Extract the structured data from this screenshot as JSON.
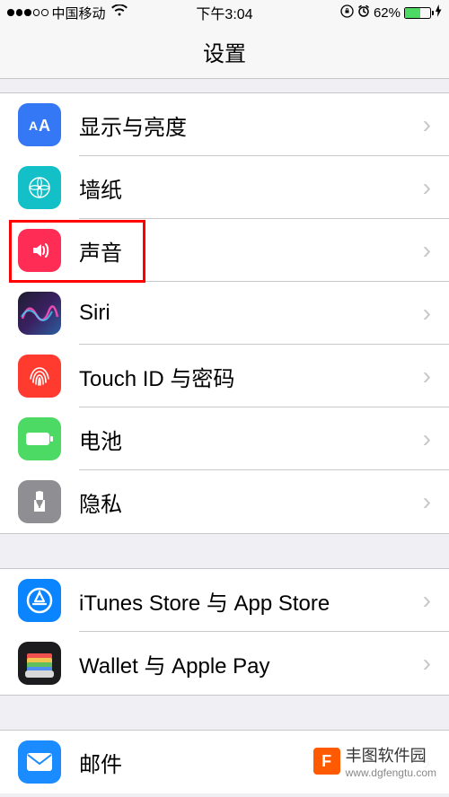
{
  "status": {
    "carrier": "中国移动",
    "time": "下午3:04",
    "battery_pct": "62%"
  },
  "nav": {
    "title": "设置"
  },
  "groups": [
    {
      "items": [
        {
          "key": "display",
          "label": "显示与亮度",
          "icon": "display-brightness-icon"
        },
        {
          "key": "wallpaper",
          "label": "墙纸",
          "icon": "wallpaper-icon"
        },
        {
          "key": "sound",
          "label": "声音",
          "icon": "sound-icon",
          "highlighted": true
        },
        {
          "key": "siri",
          "label": "Siri",
          "icon": "siri-icon"
        },
        {
          "key": "touchid",
          "label": "Touch ID 与密码",
          "icon": "touchid-icon"
        },
        {
          "key": "battery",
          "label": "电池",
          "icon": "battery-icon"
        },
        {
          "key": "privacy",
          "label": "隐私",
          "icon": "privacy-icon"
        }
      ]
    },
    {
      "items": [
        {
          "key": "itunes",
          "label": "iTunes Store 与 App Store",
          "icon": "appstore-icon"
        },
        {
          "key": "wallet",
          "label": "Wallet 与 Apple Pay",
          "icon": "wallet-icon"
        }
      ]
    },
    {
      "items": [
        {
          "key": "mail",
          "label": "邮件",
          "icon": "mail-icon"
        }
      ]
    }
  ],
  "watermark": {
    "text": "丰图软件园",
    "url": "www.dgfengtu.com"
  }
}
